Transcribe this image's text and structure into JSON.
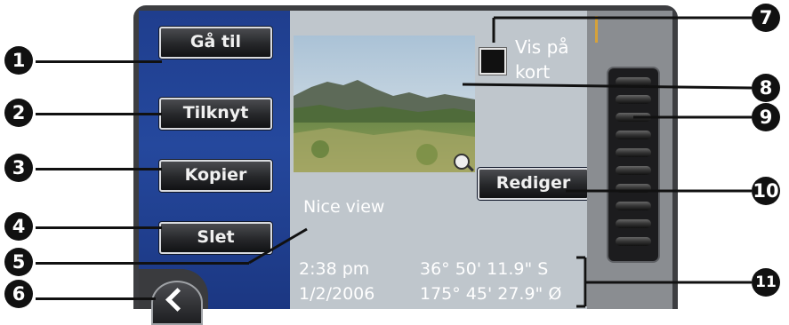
{
  "left_menu": {
    "goto_label": "Gå til",
    "link_label": "Tilknyt",
    "copy_label": "Kopier",
    "delete_label": "Slet"
  },
  "show_on_map": {
    "label_line1": "Vis på",
    "label_line2": "kort",
    "checked": false
  },
  "edit_label": "Rediger",
  "poi": {
    "name": "Nice view",
    "time": "2:38 pm",
    "date": "1/2/2006",
    "latitude": "36° 50' 11.9\" S",
    "longitude": "175° 45' 27.9\" Ø"
  },
  "callouts": [
    "1",
    "2",
    "3",
    "4",
    "5",
    "6",
    "7",
    "8",
    "9",
    "10",
    "11"
  ],
  "icons": {
    "back": "chevron-left-icon",
    "zoom": "magnifier-plus-icon",
    "scroll": "scroll-wheel-icon"
  },
  "colors": {
    "left_panel": "#25489d",
    "content_bg": "#bfc6cc",
    "button_dark": "#26272a"
  }
}
